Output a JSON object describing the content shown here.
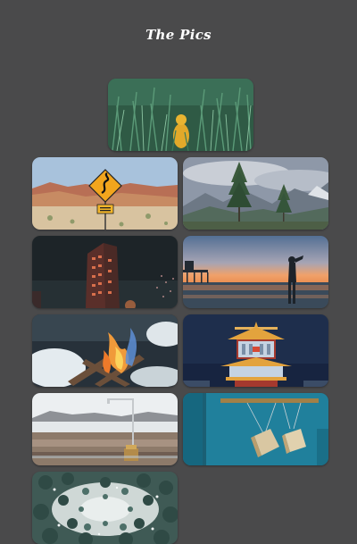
{
  "header": {
    "title": "The Pics"
  },
  "gallery": {
    "photos": [
      {
        "name": "photo-person-in-grass"
      },
      {
        "name": "photo-desert-road-sign"
      },
      {
        "name": "photo-mountain-pines"
      },
      {
        "name": "photo-flatiron-building-night"
      },
      {
        "name": "photo-woman-beach-sunset"
      },
      {
        "name": "photo-campfire-snow"
      },
      {
        "name": "photo-chinese-pagoda-night"
      },
      {
        "name": "photo-shower-in-tundra"
      },
      {
        "name": "photo-hanging-books-teal-wall"
      },
      {
        "name": "photo-snowy-forest-aerial"
      }
    ]
  },
  "colors": {
    "background": "#4a4a4b",
    "title": "#ffffff"
  }
}
